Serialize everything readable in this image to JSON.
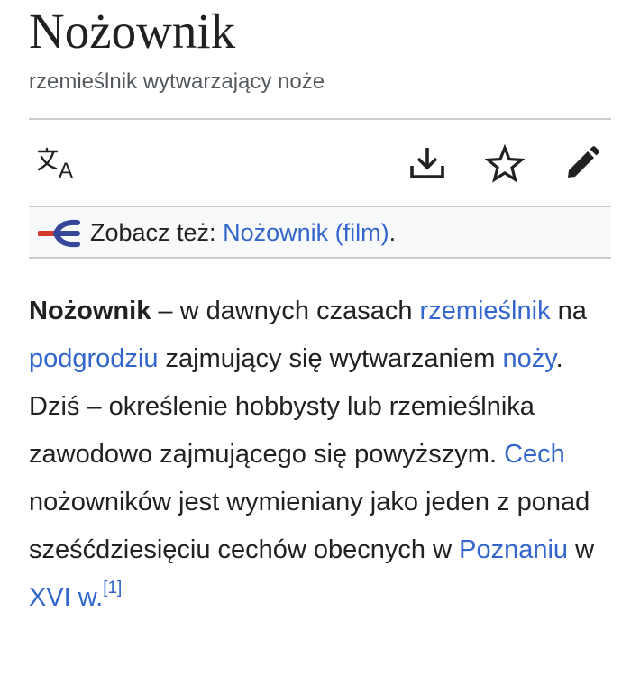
{
  "header": {
    "title": "Nożownik",
    "description": "rzemieślnik wytwarzający noże"
  },
  "toolbar": {
    "icons": [
      "language-icon",
      "download-icon",
      "star-icon",
      "edit-icon"
    ]
  },
  "hatnote": {
    "icon": "disambiguation-icon",
    "prefix": "Zobacz też:",
    "link_label": "Nożownik (film)",
    "suffix": "."
  },
  "article": {
    "parts": [
      {
        "text": "Nożownik"
      },
      {
        "text": " – w dawnych czasach "
      },
      {
        "text": "rzemieślnik"
      },
      {
        "text": " na "
      },
      {
        "text": "podgrodziu"
      },
      {
        "text": " zajmujący się wytwarzaniem "
      },
      {
        "text": "noży"
      },
      {
        "text": ". Dziś – określenie hobbysty lub rzemieślnika zawodowo zajmującego się powyższym. "
      },
      {
        "text": "Cech"
      },
      {
        "text": " nożowników jest wymieniany jako jeden z ponad sześćdziesięciu cechów obecnych w "
      },
      {
        "text": "Poznaniu"
      },
      {
        "text": " w "
      },
      {
        "text": "XVI w."
      },
      {
        "text": "[1]"
      }
    ]
  },
  "colors": {
    "link": "#3366cc",
    "text": "#202122",
    "muted": "#54595d",
    "border": "#c8ccd1",
    "hatnote_bg": "#f8f9fa",
    "disambig_red": "#d33a2c",
    "disambig_blue": "#36479a"
  }
}
